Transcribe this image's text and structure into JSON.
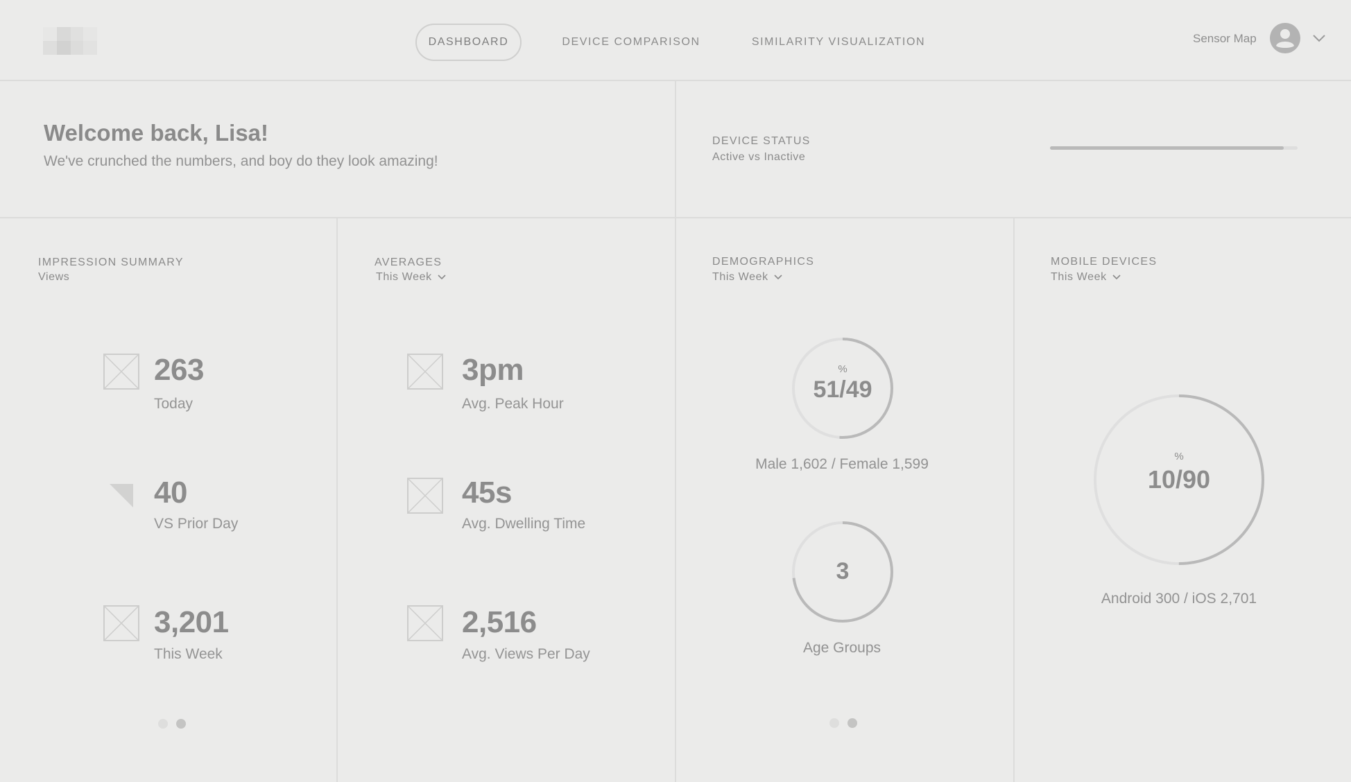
{
  "header": {
    "nav": [
      {
        "label": "DASHBOARD",
        "active": true
      },
      {
        "label": "DEVICE COMPARISON",
        "active": false
      },
      {
        "label": "SIMILARITY VISUALIZATION",
        "active": false
      }
    ],
    "user_menu_label": "Sensor Map",
    "avatar_icon": "user-avatar-icon",
    "menu_icon": "chevron-down-icon"
  },
  "welcome": {
    "title": "Welcome back, Lisa!",
    "subtitle": "We've crunched the numbers, and boy do they look amazing!"
  },
  "device_status": {
    "title": "DEVICE STATUS",
    "subtitle": "Active vs Inactive",
    "active_fraction": 0.945
  },
  "impression_summary": {
    "title": "IMPRESSION SUMMARY",
    "subtitle": "Views",
    "stats": [
      {
        "value": "263",
        "label": "Today",
        "icon": "image-placeholder-icon"
      },
      {
        "value": "40",
        "label": "VS Prior Day",
        "icon": "trend-indicator-icon"
      },
      {
        "value": "3,201",
        "label": "This Week",
        "icon": "image-placeholder-icon"
      }
    ],
    "pager": {
      "count": 2,
      "active": 1
    }
  },
  "averages": {
    "title": "AVERAGES",
    "period": "This Week",
    "stats": [
      {
        "value": "3pm",
        "label": "Avg. Peak Hour",
        "icon": "image-placeholder-icon"
      },
      {
        "value": "45s",
        "label": "Avg. Dwelling Time",
        "icon": "image-placeholder-icon"
      },
      {
        "value": "2,516",
        "label": "Avg. Views Per Day",
        "icon": "image-placeholder-icon"
      }
    ]
  },
  "demographics": {
    "title": "DEMOGRAPHICS",
    "period": "This Week",
    "gender": {
      "unit": "%",
      "value": "51/49",
      "caption": "Male 1,602 / Female 1,599",
      "fraction": 0.51
    },
    "age": {
      "value": "3",
      "caption": "Age Groups",
      "fraction": 0.73
    },
    "pager": {
      "count": 2,
      "active": 1
    }
  },
  "mobile_devices": {
    "title": "MOBILE DEVICES",
    "period": "This Week",
    "split": {
      "unit": "%",
      "value": "10/90",
      "caption": "Android 300 / iOS 2,701",
      "fraction": 0.5
    }
  },
  "colors": {
    "background": "#ebebea",
    "divider": "#dcdcdb",
    "text": "#8a8a8a",
    "ring_track": "#dfdfdf",
    "ring_fill": "#b9b9b9"
  }
}
